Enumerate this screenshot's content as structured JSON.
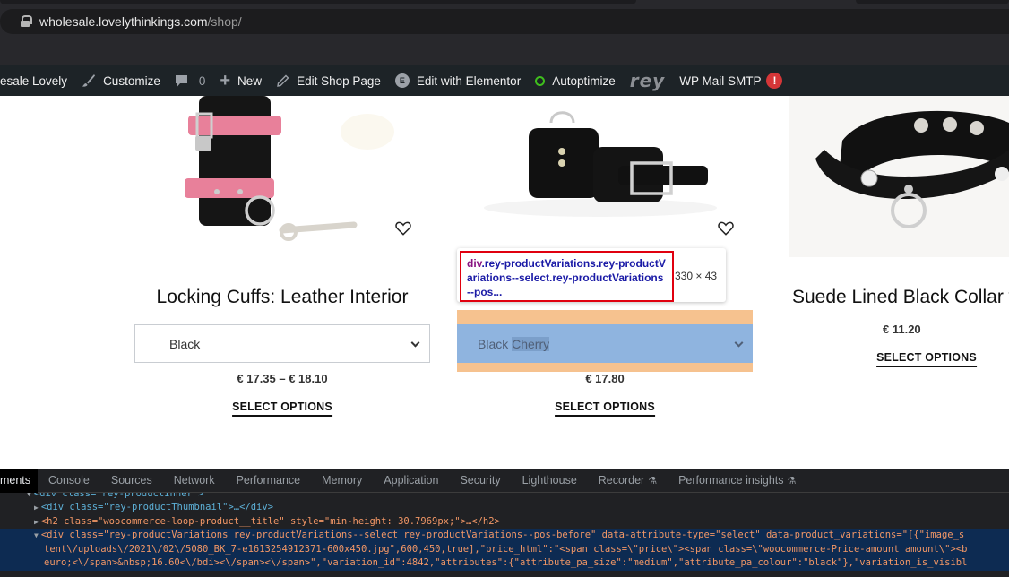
{
  "browser": {
    "url_host": "wholesale.lovelythinkings.com",
    "url_path": "/shop/"
  },
  "admin_bar": {
    "site_name": "esale Lovely",
    "customize": "Customize",
    "comments_count": "0",
    "new": "New",
    "edit_shop_page": "Edit Shop Page",
    "edit_with_elementor": "Edit with Elementor",
    "autoptimize": "Autoptimize",
    "rey": "rey",
    "wp_mail_smtp": "WP Mail SMTP",
    "alert": "!"
  },
  "products": [
    {
      "title": "Locking Cuffs: Leather Interior",
      "variation_selected": "Black",
      "price": "€ 17.35 – € 18.10",
      "action": "SELECT OPTIONS"
    },
    {
      "title": "",
      "variation_selected": "Black Cherry",
      "price": "€ 17.80",
      "action": "SELECT OPTIONS"
    },
    {
      "title": "Suede Lined Black Collar with",
      "price": "€ 11.20",
      "action": "SELECT OPTIONS"
    }
  ],
  "inspector_tooltip": {
    "tag": "div",
    "classes": ".rey-productVariations.rey-productVariations--select.rey-productVariations--pos...",
    "dimensions": "330 × 43"
  },
  "devtools": {
    "tabs": [
      {
        "label": "Elements",
        "active": true
      },
      {
        "label": "Console"
      },
      {
        "label": "Sources"
      },
      {
        "label": "Network"
      },
      {
        "label": "Performance"
      },
      {
        "label": "Memory"
      },
      {
        "label": "Application"
      },
      {
        "label": "Security"
      },
      {
        "label": "Lighthouse"
      },
      {
        "label": "Recorder",
        "experimental": true
      },
      {
        "label": "Performance insights",
        "experimental": true
      }
    ],
    "dom_lines": [
      "<div class=\"rey-productInner\">",
      "<div class=\"rey-productThumbnail\">…</div>",
      "<h2 class=\"woocommerce-loop-product__title\" style=\"min-height: 30.7969px;\">…</h2>",
      "<div class=\"rey-productVariations rey-productVariations--select rey-productVariations--pos-before\" data-attribute-type=\"select\" data-product_variations=\"[{\"image_s",
      "tent\\/uploads\\/2021\\/02\\/5080_BK_7-e1613254912371-600x450.jpg\",600,450,true],\"price_html\":\"<span class=\\\"price\\\"><span class=\\\"woocommerce-Price-amount amount\\\"><b",
      "euro;<\\/span>&nbsp;16.60<\\/bdi><\\/span><\\/span>\",\"variation_id\":4842,\"attributes\":{\"attribute_pa_size\":\"medium\",\"attribute_pa_colour\":\"black\"},\"variation_is_visibl"
    ]
  }
}
